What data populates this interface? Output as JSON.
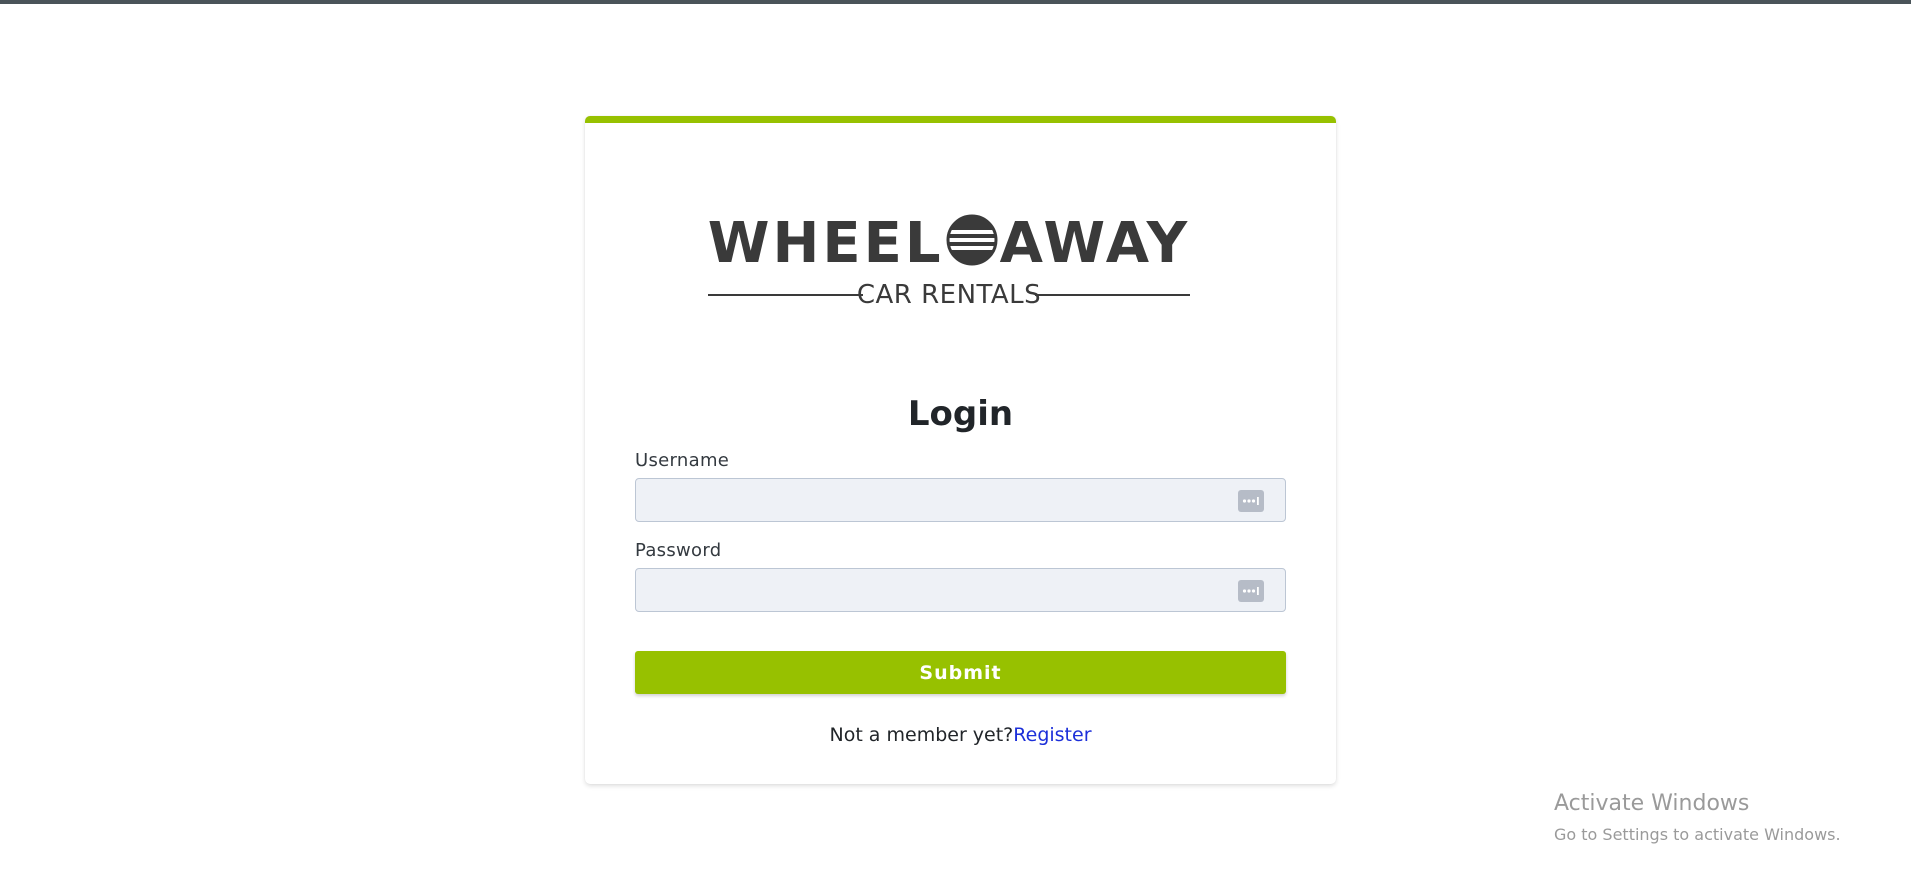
{
  "brand": {
    "name_left": "WHEEL",
    "name_right": "AWAY",
    "tagline": "CAR RENTALS",
    "accent_color": "#97c100",
    "link_color": "#1c2fd9"
  },
  "form": {
    "title": "Login",
    "username_label": "Username",
    "username_value": "",
    "password_label": "Password",
    "password_value": "",
    "submit_label": "Submit",
    "field_icon": "password-manager-icon"
  },
  "footer": {
    "prompt": "Not a member yet?",
    "register_label": "Register"
  },
  "windows_watermark": {
    "title": "Activate Windows",
    "subtitle": "Go to Settings to activate Windows."
  }
}
